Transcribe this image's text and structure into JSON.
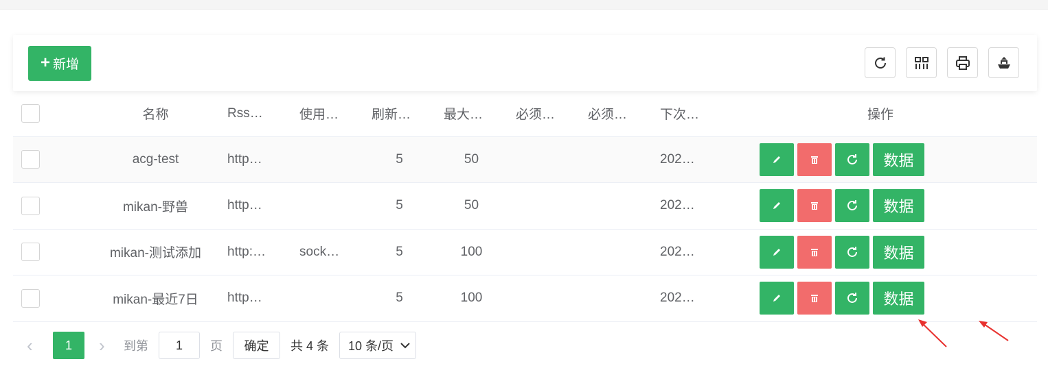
{
  "toolbar": {
    "add_label": "新增",
    "icons": [
      "refresh-icon",
      "columns-icon",
      "print-icon",
      "export-icon"
    ]
  },
  "table": {
    "headers": [
      "名称",
      "Rss…",
      "使用…",
      "刷新…",
      "最大…",
      "必须…",
      "必须…",
      "下次…",
      "操作"
    ],
    "rows": [
      {
        "name": "acg-test",
        "rss": "http…",
        "use": "",
        "refresh": "5",
        "max": "50",
        "must1": "",
        "must2": "",
        "next": "202…"
      },
      {
        "name": "mikan-野兽",
        "rss": "http…",
        "use": "",
        "refresh": "5",
        "max": "50",
        "must1": "",
        "must2": "",
        "next": "202…"
      },
      {
        "name": "mikan-测试添加",
        "rss": "http:…",
        "use": "sock…",
        "refresh": "5",
        "max": "100",
        "must1": "",
        "must2": "",
        "next": "202…"
      },
      {
        "name": "mikan-最近7日",
        "rss": "http…",
        "use": "",
        "refresh": "5",
        "max": "100",
        "must1": "",
        "must2": "",
        "next": "202…"
      }
    ],
    "data_button_label": "数据"
  },
  "pagination": {
    "current_page": "1",
    "goto_label": "到第",
    "goto_value": "1",
    "page_unit": "页",
    "confirm_label": "确定",
    "total_text": "共 4 条",
    "page_size": "10 条/页"
  },
  "colors": {
    "primary": "#33b466",
    "danger": "#f26c6c",
    "annotation": "#e8322f"
  }
}
